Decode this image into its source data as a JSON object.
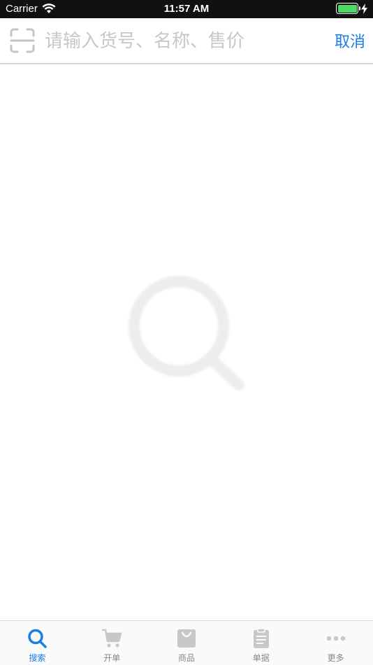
{
  "status_bar": {
    "carrier": "Carrier",
    "time": "11:57 AM",
    "icons": [
      "wifi-icon",
      "battery-icon",
      "charging-bolt-icon"
    ]
  },
  "search": {
    "placeholder": "请输入货号、名称、售价",
    "value": "",
    "cancel_label": "取消",
    "scan_icon": "scan-icon"
  },
  "content": {
    "empty_icon": "magnifier-icon"
  },
  "tabs": [
    {
      "label": "搜索",
      "icon": "search-icon",
      "active": true
    },
    {
      "label": "开单",
      "icon": "cart-icon",
      "active": false
    },
    {
      "label": "商品",
      "icon": "bag-icon",
      "active": false
    },
    {
      "label": "单据",
      "icon": "clipboard-icon",
      "active": false
    },
    {
      "label": "更多",
      "icon": "more-icon",
      "active": false
    }
  ],
  "colors": {
    "accent": "#1a7ee6",
    "inactive": "#888888",
    "icon_inactive": "#c8c8c8",
    "battery": "#4cd964"
  }
}
